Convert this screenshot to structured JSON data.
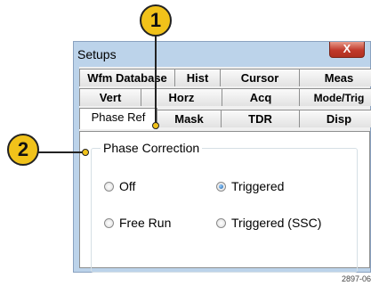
{
  "window": {
    "title": "Setups",
    "close_label": "X"
  },
  "tabs": {
    "row1": [
      "Wfm Database",
      "Hist",
      "Cursor",
      "Meas"
    ],
    "row2": [
      "Vert",
      "Horz",
      "Acq",
      "Mode/Trig"
    ],
    "row3": [
      "Phase Ref",
      "Mask",
      "TDR",
      "Disp"
    ],
    "selected": "Phase Ref"
  },
  "group": {
    "legend": "Phase Correction",
    "options": [
      "Off",
      "Triggered",
      "Free Run",
      "Triggered (SSC)"
    ],
    "selected": "Triggered"
  },
  "callouts": [
    "1",
    "2"
  ],
  "figure_id": "2897-06"
}
